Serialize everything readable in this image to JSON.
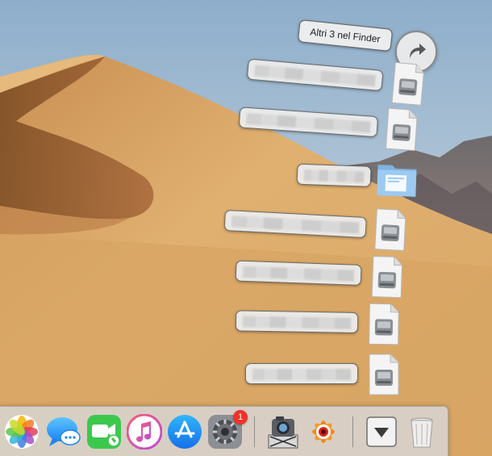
{
  "fan": {
    "finder_label": "Altri 3 nel Finder",
    "open_in_finder_icon": "curved-arrow-icon",
    "items": [
      {
        "kind": "document",
        "icon": "disk-image-icon",
        "label": ""
      },
      {
        "kind": "document",
        "icon": "disk-image-icon",
        "label": ""
      },
      {
        "kind": "folder",
        "icon": "folder-icon",
        "label": ""
      },
      {
        "kind": "document",
        "icon": "disk-image-icon",
        "label": ""
      },
      {
        "kind": "document",
        "icon": "disk-image-icon",
        "label": ""
      },
      {
        "kind": "document",
        "icon": "disk-image-icon",
        "label": ""
      },
      {
        "kind": "document",
        "icon": "disk-image-icon",
        "label": ""
      }
    ]
  },
  "dock": {
    "apps": [
      {
        "name": "Foto",
        "icon": "photos-icon"
      },
      {
        "name": "Messaggi",
        "icon": "messages-icon"
      },
      {
        "name": "FaceTime",
        "icon": "facetime-icon"
      },
      {
        "name": "iTunes",
        "icon": "itunes-icon"
      },
      {
        "name": "App Store",
        "icon": "app-store-icon"
      },
      {
        "name": "Preferenze di Sistema",
        "icon": "system-preferences-icon",
        "badge": "1"
      },
      {
        "name": "Image Capture",
        "icon": "image-capture-icon"
      },
      {
        "name": "XnView",
        "icon": "xnview-icon"
      },
      {
        "name": "Stack",
        "icon": "stack-arrow-icon"
      },
      {
        "name": "Cestino",
        "icon": "trash-icon"
      }
    ]
  },
  "colors": {
    "badge": "#f0332a",
    "sky": "#a9c2d8",
    "dune": "#d9a867"
  }
}
